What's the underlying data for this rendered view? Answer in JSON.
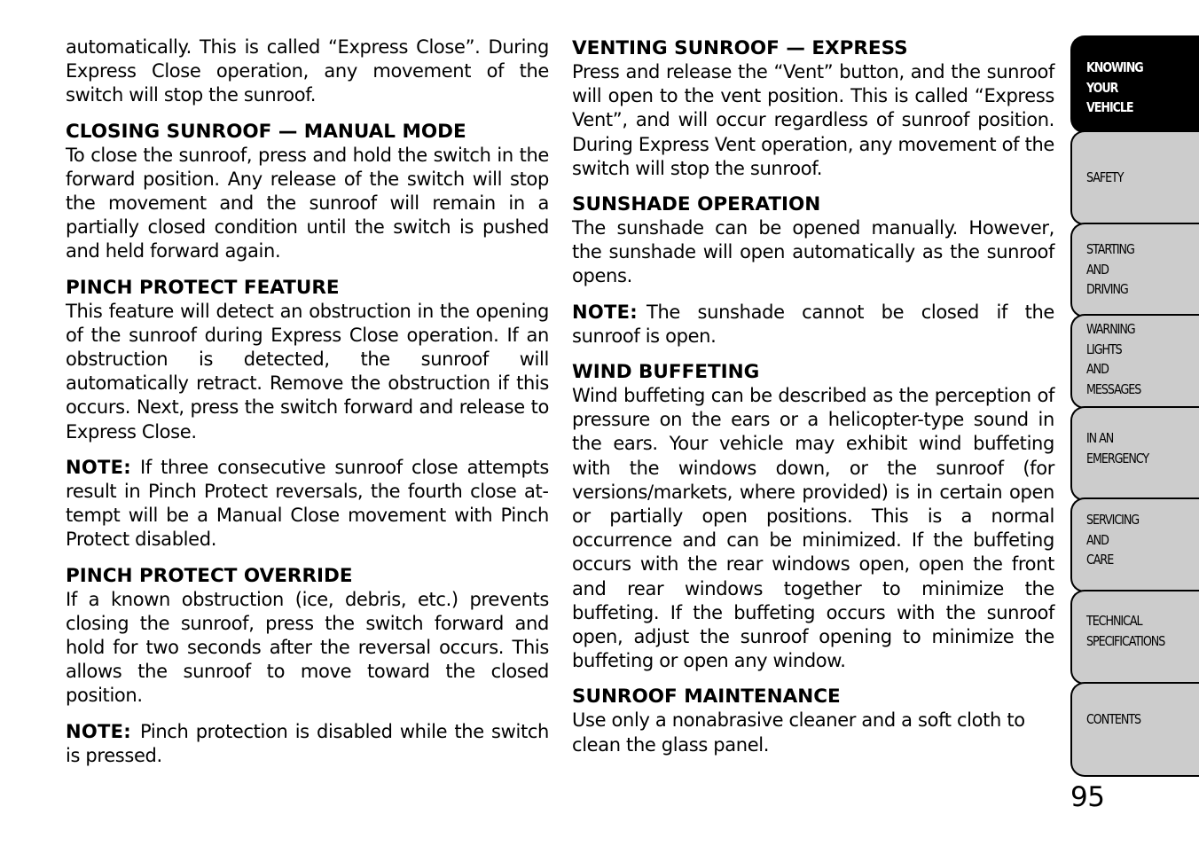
{
  "left_column": {
    "intro": "automatically. This is called “Express Close”. During Express Close operation, any movement of the switch will stop the sunroof.",
    "closing_manual": {
      "heading": "CLOSING SUNROOF — MANUAL MODE",
      "body": "To close the sunroof, press and hold the switch in the forward position. Any release of the switch will stop the movement and the sunroof will remain in a partially closed condition until the switch is pushed and held forward again."
    },
    "pinch_feature": {
      "heading": "PINCH PROTECT FEATURE",
      "body": "This feature will detect an obstruction in the opening of the sunroof during Express Close operation. If an obstruction is detected, the sunroof will automatically retract. Remove the obstruction if this occurs. Next, press the switch forward and release to Express Close."
    },
    "note1": {
      "label": "NOTE:",
      "text": "If three consecutive sunroof close attempts result in Pinch Protect reversals, the fourth close at­tempt will be a Manual Close movement with Pinch Protect disabled."
    },
    "pinch_override": {
      "heading": "PINCH PROTECT OVERRIDE",
      "body": "If a known obstruction (ice, debris, etc.) prevents closing the sunroof, press the switch forward and hold for two seconds after the reversal occurs. This allows the sunroof to move toward the closed position."
    },
    "note2": {
      "label": "NOTE:",
      "text": "Pinch protection is disabled while the switch is pressed."
    }
  },
  "right_column": {
    "venting": {
      "heading": "VENTING SUNROOF — EXPRESS",
      "body": "Press and release the “Vent” button, and the sunroof will open to the vent position. This is called “Express Vent”, and will occur regardless of sunroof position. During Express Vent operation, any movement of the switch will stop the sunroof."
    },
    "sunshade": {
      "heading": "SUNSHADE OPERATION",
      "body": "The sunshade can be opened manually. However, the sunshade will open automatically as the sunroof opens."
    },
    "note3": {
      "label": "NOTE:",
      "text": "The sunshade cannot be closed if the sunroof is open."
    },
    "wind": {
      "heading": "WIND BUFFETING",
      "body": "Wind buffeting can be described as the perception of pressure on the ears or a helicopter-type sound in the ears. Your vehicle may exhibit wind buffeting with the windows down, or the sunroof (for versions/markets, where provided) is in certain open or partially open positions. This is a normal occurrence and can be minimized. If the buffeting occurs with the rear win­dows open, open the front and rear windows together to minimize the buffeting. If the buffeting occurs with the sunroof open, adjust the sunroof opening to mini­mize the buffeting or open any window."
    },
    "maintenance": {
      "heading": "SUNROOF MAINTENANCE",
      "body": "Use only a nonabrasive cleaner and a soft cloth to clean the glass panel."
    }
  },
  "tabs": [
    {
      "label": "KNOWING\nYOUR\nVEHICLE",
      "active": true
    },
    {
      "label": "SAFETY"
    },
    {
      "label": "STARTING\nAND\nDRIVING"
    },
    {
      "label": "WARNING\nLIGHTS\nAND\nMESSAGES"
    },
    {
      "label": "IN AN\nEMERGENCY"
    },
    {
      "label": "SERVICING\nAND\nCARE"
    },
    {
      "label": "TECHNICAL\nSPECIFICATIONS"
    },
    {
      "label": "CONTENTS"
    }
  ],
  "page_number": "95",
  "colors": {
    "tab_active_bg": "#000000",
    "tab_bg": "#cccccc",
    "text": "#000000"
  }
}
